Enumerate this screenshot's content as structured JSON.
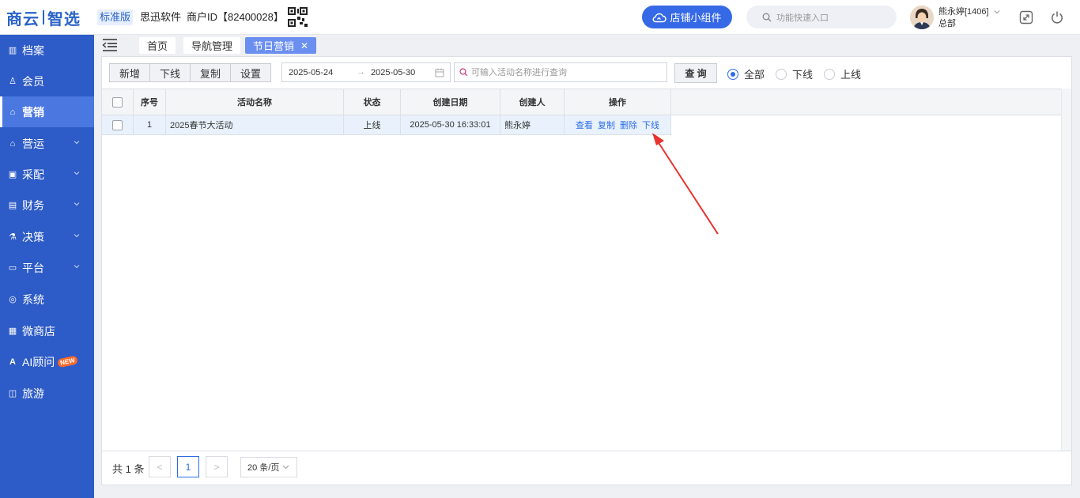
{
  "header": {
    "logo_text_a": "商云",
    "logo_text_b": "智选",
    "edition": "标准版",
    "company": "思迅软件",
    "merchant_id": "商户ID【82400028】",
    "widget_button": "店铺小组件",
    "quick_search_placeholder": "功能快速入口",
    "user_name": "熊永婷[1406]",
    "user_dept": "总部",
    "icons": [
      "qrcode-icon",
      "cloud-icon",
      "search-icon",
      "chevron-down-icon",
      "fullscreen-icon",
      "power-icon"
    ]
  },
  "sidebar": {
    "items": [
      {
        "label": "档案",
        "icon": "archive-icon",
        "expandable": false,
        "active": false
      },
      {
        "label": "会员",
        "icon": "user-icon",
        "expandable": false,
        "active": false
      },
      {
        "label": "营销",
        "icon": "shop-icon",
        "expandable": false,
        "active": true
      },
      {
        "label": "营运",
        "icon": "shop-icon",
        "expandable": true,
        "active": false
      },
      {
        "label": "采配",
        "icon": "box-icon",
        "expandable": true,
        "active": false
      },
      {
        "label": "财务",
        "icon": "wallet-icon",
        "expandable": true,
        "active": false
      },
      {
        "label": "决策",
        "icon": "chart-icon",
        "expandable": true,
        "active": false
      },
      {
        "label": "平台",
        "icon": "monitor-icon",
        "expandable": true,
        "active": false
      },
      {
        "label": "系统",
        "icon": "gear-icon",
        "expandable": false,
        "active": false
      },
      {
        "label": "微商店",
        "icon": "store-icon",
        "expandable": false,
        "active": false
      },
      {
        "label": "AI顾问",
        "icon": "ai-icon",
        "expandable": false,
        "active": false,
        "badge": "NEW"
      },
      {
        "label": "旅游",
        "icon": "travel-icon",
        "expandable": false,
        "active": false
      }
    ]
  },
  "tabs": [
    {
      "label": "首页",
      "active": false
    },
    {
      "label": "导航管理",
      "active": false
    },
    {
      "label": "节日营销",
      "active": true,
      "closable": true
    }
  ],
  "toolbar": {
    "add": "新增",
    "offline": "下线",
    "copy": "复制",
    "settings": "设置",
    "date_from": "2025-05-24",
    "date_arrow": "→",
    "date_to": "2025-05-30",
    "search_placeholder": "可输入活动名称进行查询",
    "query": "查 询",
    "filters": [
      {
        "label": "全部",
        "selected": true
      },
      {
        "label": "下线",
        "selected": false
      },
      {
        "label": "上线",
        "selected": false
      }
    ]
  },
  "table": {
    "columns": [
      "序号",
      "活动名称",
      "状态",
      "创建日期",
      "创建人",
      "操作"
    ],
    "rows": [
      {
        "index": "1",
        "name": "2025春节大活动",
        "status": "上线",
        "created": "2025-05-30 16:33:01",
        "creator": "熊永婷",
        "actions": [
          "查看",
          "复制",
          "删除",
          "下线"
        ]
      }
    ]
  },
  "pager": {
    "total": "共 1 条",
    "prev": "<",
    "current": "1",
    "next": ">",
    "page_size": "20 条/页"
  },
  "colors": {
    "sidebar": "#2d5bc7",
    "accent": "#2d6ce6",
    "arrow": "#e8332f"
  }
}
